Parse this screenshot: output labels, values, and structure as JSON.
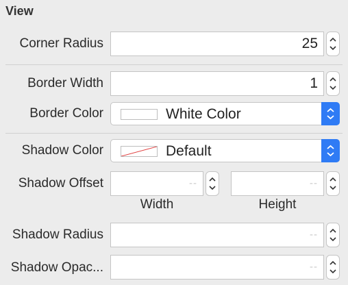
{
  "section": {
    "title": "View"
  },
  "corner_radius": {
    "label": "Corner Radius",
    "value": "25"
  },
  "border_width": {
    "label": "Border Width",
    "value": "1"
  },
  "border_color": {
    "label": "Border Color",
    "value": "White Color"
  },
  "shadow_color": {
    "label": "Shadow Color",
    "value": "Default"
  },
  "shadow_offset": {
    "label": "Shadow Offset",
    "width_value": "--",
    "height_value": "--",
    "width_label": "Width",
    "height_label": "Height"
  },
  "shadow_radius": {
    "label": "Shadow Radius",
    "value": "--"
  },
  "shadow_opacity": {
    "label": "Shadow Opac...",
    "value": "--"
  },
  "colors": {
    "accent": "#2f7bf5",
    "background": "#ececec"
  }
}
